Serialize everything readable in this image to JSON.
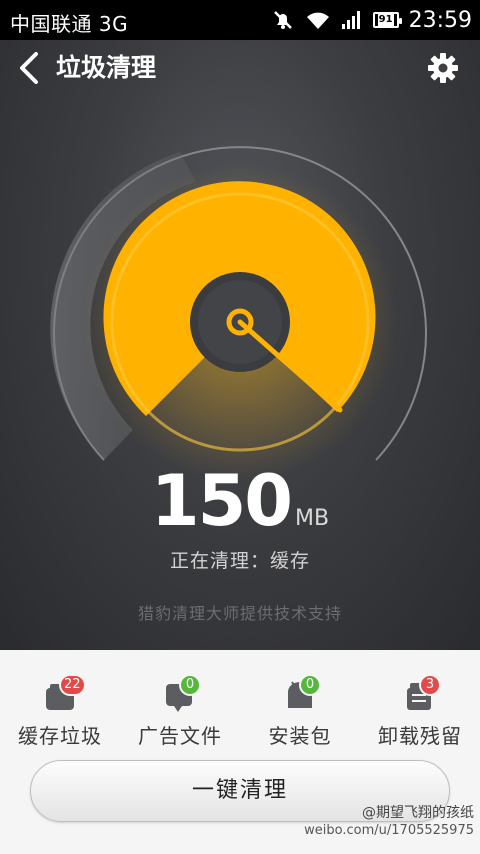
{
  "status_bar": {
    "carrier": "中国联通 3G",
    "battery": "91",
    "time": "23:59",
    "icons": [
      "mute-icon",
      "wifi-icon",
      "signal-icon",
      "battery-icon"
    ]
  },
  "header": {
    "title": "垃圾清理",
    "back_icon": "chevron-left-icon",
    "settings_icon": "gear-icon"
  },
  "gauge": {
    "size_value": "150",
    "size_unit": "MB",
    "status": "正在清理：缓存",
    "powered_by": "猎豹清理大师提供技术支持",
    "colors": {
      "accent": "#FFB300",
      "accent_light": "#FFC93C",
      "ring": "#8a8b8f",
      "hub": "#3a3b3f"
    }
  },
  "categories": [
    {
      "label": "缓存垃圾",
      "count": "22",
      "badge_color": "red",
      "icon": "cache-icon"
    },
    {
      "label": "广告文件",
      "count": "0",
      "badge_color": "green",
      "icon": "ad-file-icon"
    },
    {
      "label": "安装包",
      "count": "0",
      "badge_color": "green",
      "icon": "apk-icon"
    },
    {
      "label": "卸载残留",
      "count": "3",
      "badge_color": "red",
      "icon": "uninstall-residue-icon"
    }
  ],
  "action": {
    "clean_label": "一键清理"
  },
  "watermark": {
    "handle": "@期望飞翔的孩纸",
    "url": "weibo.com/u/1705525975"
  }
}
